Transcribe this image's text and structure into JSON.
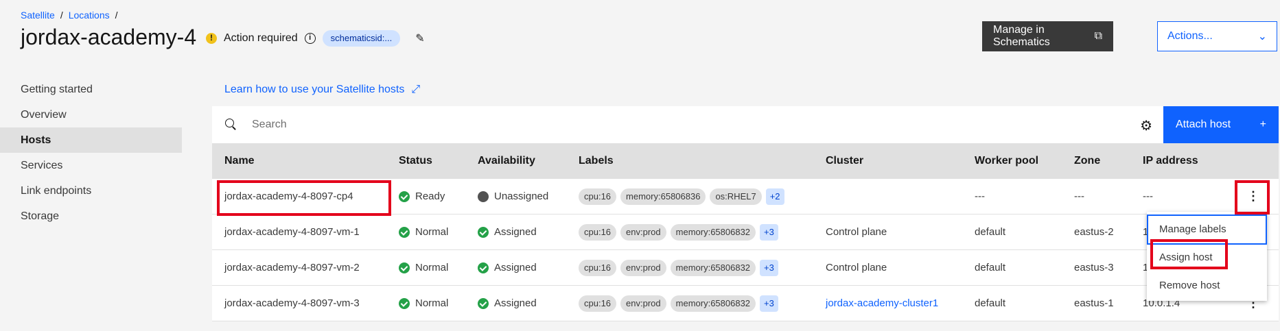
{
  "breadcrumb": {
    "items": [
      "Satellite",
      "Locations"
    ]
  },
  "title": "jordax-academy-4",
  "status": {
    "text": "Action required",
    "tag": "schematicsid:..."
  },
  "buttons": {
    "manage": "Manage in Schematics",
    "actions": "Actions...",
    "attach": "Attach host"
  },
  "sidebar": {
    "items": [
      {
        "label": "Getting started"
      },
      {
        "label": "Overview"
      },
      {
        "label": "Hosts"
      },
      {
        "label": "Services"
      },
      {
        "label": "Link endpoints"
      },
      {
        "label": "Storage"
      }
    ]
  },
  "learn_link": "Learn how to use your Satellite hosts",
  "search": {
    "placeholder": "Search"
  },
  "table": {
    "headers": [
      "Name",
      "Status",
      "Availability",
      "Labels",
      "Cluster",
      "Worker pool",
      "Zone",
      "IP address"
    ],
    "rows": [
      {
        "name": "jordax-academy-4-8097-cp4",
        "status": "Ready",
        "availability": "Unassigned",
        "labels": [
          "cpu:16",
          "memory:65806836",
          "os:RHEL7"
        ],
        "more": "+2",
        "cluster": "",
        "pool": "---",
        "zone": "---",
        "ip": "---"
      },
      {
        "name": "jordax-academy-4-8097-vm-1",
        "status": "Normal",
        "availability": "Assigned",
        "labels": [
          "cpu:16",
          "env:prod",
          "memory:65806832"
        ],
        "more": "+3",
        "cluster": "Control plane",
        "pool": "default",
        "zone": "eastus-2",
        "ip": "1"
      },
      {
        "name": "jordax-academy-4-8097-vm-2",
        "status": "Normal",
        "availability": "Assigned",
        "labels": [
          "cpu:16",
          "env:prod",
          "memory:65806832"
        ],
        "more": "+3",
        "cluster": "Control plane",
        "pool": "default",
        "zone": "eastus-3",
        "ip": "1"
      },
      {
        "name": "jordax-academy-4-8097-vm-3",
        "status": "Normal",
        "availability": "Assigned",
        "labels": [
          "cpu:16",
          "env:prod",
          "memory:65806832"
        ],
        "more": "+3",
        "cluster": "jordax-academy-cluster1",
        "pool": "default",
        "zone": "eastus-1",
        "ip": "10.0.1.4"
      }
    ]
  },
  "menu": {
    "items": [
      "Manage labels",
      "Assign host",
      "Remove host"
    ]
  },
  "colors": {
    "accent": "#0f62fe",
    "highlight": "#e3001b",
    "ok": "#24a148",
    "warning": "#f1c21b"
  }
}
